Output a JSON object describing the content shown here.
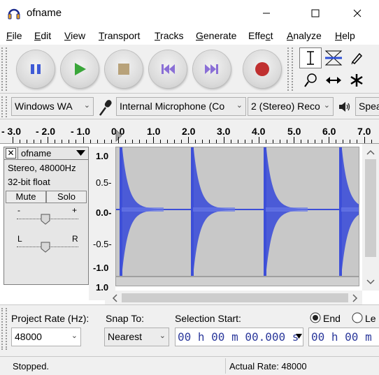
{
  "window": {
    "title": "ofname"
  },
  "menu": {
    "items": [
      {
        "label": "File",
        "underline": "F",
        "rest": "ile"
      },
      {
        "label": "Edit",
        "underline": "E",
        "rest": "dit"
      },
      {
        "label": "View",
        "underline": "V",
        "rest": "iew"
      },
      {
        "label": "Transport",
        "underline": "T",
        "rest": "ransport"
      },
      {
        "label": "Tracks",
        "underline": "T",
        "rest": "racks"
      },
      {
        "label": "Generate",
        "underline": "G",
        "rest": "enerate"
      },
      {
        "label": "Effect",
        "pre": "Effe",
        "underline": "c",
        "rest": "t"
      },
      {
        "label": "Analyze",
        "underline": "A",
        "rest": "nalyze"
      },
      {
        "label": "Help",
        "underline": "H",
        "rest": "elp"
      }
    ]
  },
  "transport": {
    "buttons": [
      "pause",
      "play",
      "stop",
      "skip-to-start",
      "skip-to-end",
      "record"
    ],
    "colors": {
      "pause": "#3f5bd6",
      "play": "#3aa63a",
      "stop": "#b8a27a",
      "skip": "#8a6fd6",
      "record": "#c03030"
    }
  },
  "tools": [
    "selection",
    "envelope",
    "draw",
    "zoom",
    "time-shift",
    "multi"
  ],
  "devices": {
    "host": "Windows WA",
    "input": "Internal Microphone (Co",
    "channels": "2 (Stereo) Reco",
    "output": "Spea"
  },
  "ruler": {
    "labels": [
      "- 3.0",
      "- 2.0",
      "- 1.0",
      "0.0",
      "1.0",
      "2.0",
      "3.0",
      "4.0",
      "5.0",
      "6.0",
      "7.0"
    ]
  },
  "track": {
    "name": "ofname",
    "format": "Stereo, 48000Hz",
    "bitdepth": "32-bit float",
    "mute_label": "Mute",
    "solo_label": "Solo",
    "gain_minus": "-",
    "gain_plus": "+",
    "pan_left": "L",
    "pan_right": "R",
    "vruler": [
      "1.0",
      "0.5-",
      "0.0-",
      "-0.5-",
      "-1.0",
      "1.0"
    ],
    "wave_color": "#3d4fd8"
  },
  "selection": {
    "project_rate_label": "Project Rate (Hz):",
    "project_rate": "48000",
    "snap_label": "Snap To:",
    "snap_value": "Nearest",
    "start_label": "Selection Start:",
    "start_value": "00 h 00 m 00.000 s",
    "end_label": "End",
    "length_label": "Le",
    "end_value": "00 h 00 m"
  },
  "status": {
    "left": "Stopped.",
    "right": "Actual Rate: 48000"
  }
}
